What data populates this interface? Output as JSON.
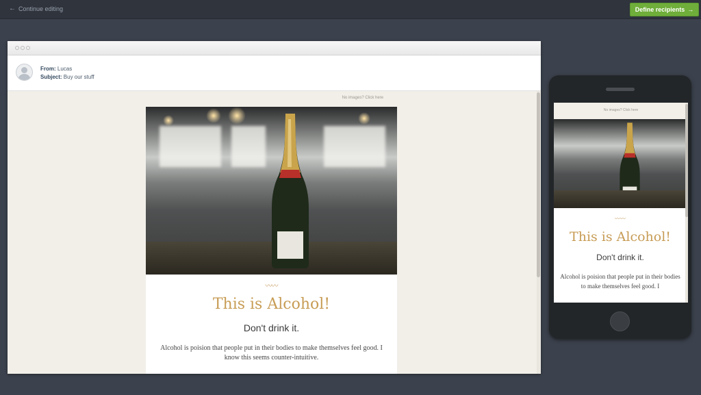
{
  "topbar": {
    "back_label": "Continue editing",
    "cta_label": "Define recipients"
  },
  "desktop": {
    "from_label": "From:",
    "from_value": "Lucas",
    "subject_label": "Subject:",
    "subject_value": "Buy our stuff",
    "no_images": "No images?  Click here"
  },
  "email": {
    "headline": "This is Alcohol!",
    "subhead": "Don't drink it.",
    "body_desktop": "Alcohol is poision that people put in their bodies to make themselves feel good. I know this seems counter-intuitive.",
    "body_mobile": "Alcohol is poision that people put in their bodies to make themselves feel good. I"
  },
  "mobile": {
    "no_images": "No images?  Click here"
  },
  "colors": {
    "accent_gold": "#c79c55",
    "cta_green": "#6fae3a"
  }
}
